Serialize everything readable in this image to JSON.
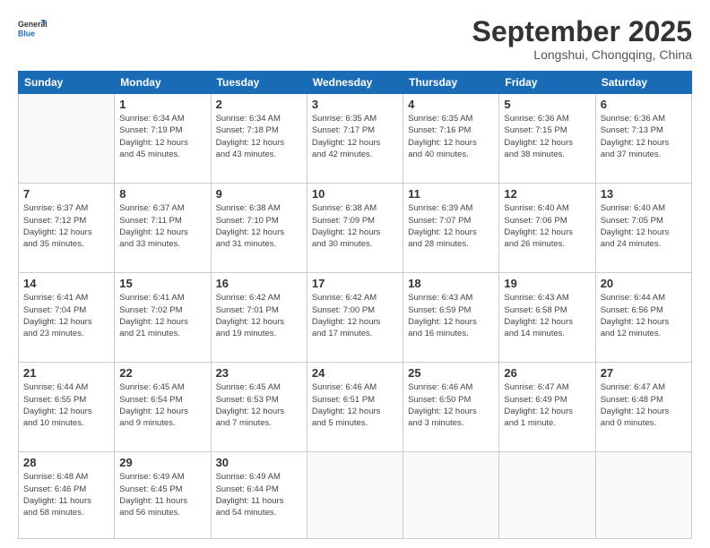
{
  "header": {
    "logo_general": "General",
    "logo_blue": "Blue",
    "month": "September 2025",
    "location": "Longshui, Chongqing, China"
  },
  "days_of_week": [
    "Sunday",
    "Monday",
    "Tuesday",
    "Wednesday",
    "Thursday",
    "Friday",
    "Saturday"
  ],
  "weeks": [
    [
      {
        "day": "",
        "info": ""
      },
      {
        "day": "1",
        "info": "Sunrise: 6:34 AM\nSunset: 7:19 PM\nDaylight: 12 hours\nand 45 minutes."
      },
      {
        "day": "2",
        "info": "Sunrise: 6:34 AM\nSunset: 7:18 PM\nDaylight: 12 hours\nand 43 minutes."
      },
      {
        "day": "3",
        "info": "Sunrise: 6:35 AM\nSunset: 7:17 PM\nDaylight: 12 hours\nand 42 minutes."
      },
      {
        "day": "4",
        "info": "Sunrise: 6:35 AM\nSunset: 7:16 PM\nDaylight: 12 hours\nand 40 minutes."
      },
      {
        "day": "5",
        "info": "Sunrise: 6:36 AM\nSunset: 7:15 PM\nDaylight: 12 hours\nand 38 minutes."
      },
      {
        "day": "6",
        "info": "Sunrise: 6:36 AM\nSunset: 7:13 PM\nDaylight: 12 hours\nand 37 minutes."
      }
    ],
    [
      {
        "day": "7",
        "info": "Sunrise: 6:37 AM\nSunset: 7:12 PM\nDaylight: 12 hours\nand 35 minutes."
      },
      {
        "day": "8",
        "info": "Sunrise: 6:37 AM\nSunset: 7:11 PM\nDaylight: 12 hours\nand 33 minutes."
      },
      {
        "day": "9",
        "info": "Sunrise: 6:38 AM\nSunset: 7:10 PM\nDaylight: 12 hours\nand 31 minutes."
      },
      {
        "day": "10",
        "info": "Sunrise: 6:38 AM\nSunset: 7:09 PM\nDaylight: 12 hours\nand 30 minutes."
      },
      {
        "day": "11",
        "info": "Sunrise: 6:39 AM\nSunset: 7:07 PM\nDaylight: 12 hours\nand 28 minutes."
      },
      {
        "day": "12",
        "info": "Sunrise: 6:40 AM\nSunset: 7:06 PM\nDaylight: 12 hours\nand 26 minutes."
      },
      {
        "day": "13",
        "info": "Sunrise: 6:40 AM\nSunset: 7:05 PM\nDaylight: 12 hours\nand 24 minutes."
      }
    ],
    [
      {
        "day": "14",
        "info": "Sunrise: 6:41 AM\nSunset: 7:04 PM\nDaylight: 12 hours\nand 23 minutes."
      },
      {
        "day": "15",
        "info": "Sunrise: 6:41 AM\nSunset: 7:02 PM\nDaylight: 12 hours\nand 21 minutes."
      },
      {
        "day": "16",
        "info": "Sunrise: 6:42 AM\nSunset: 7:01 PM\nDaylight: 12 hours\nand 19 minutes."
      },
      {
        "day": "17",
        "info": "Sunrise: 6:42 AM\nSunset: 7:00 PM\nDaylight: 12 hours\nand 17 minutes."
      },
      {
        "day": "18",
        "info": "Sunrise: 6:43 AM\nSunset: 6:59 PM\nDaylight: 12 hours\nand 16 minutes."
      },
      {
        "day": "19",
        "info": "Sunrise: 6:43 AM\nSunset: 6:58 PM\nDaylight: 12 hours\nand 14 minutes."
      },
      {
        "day": "20",
        "info": "Sunrise: 6:44 AM\nSunset: 6:56 PM\nDaylight: 12 hours\nand 12 minutes."
      }
    ],
    [
      {
        "day": "21",
        "info": "Sunrise: 6:44 AM\nSunset: 6:55 PM\nDaylight: 12 hours\nand 10 minutes."
      },
      {
        "day": "22",
        "info": "Sunrise: 6:45 AM\nSunset: 6:54 PM\nDaylight: 12 hours\nand 9 minutes."
      },
      {
        "day": "23",
        "info": "Sunrise: 6:45 AM\nSunset: 6:53 PM\nDaylight: 12 hours\nand 7 minutes."
      },
      {
        "day": "24",
        "info": "Sunrise: 6:46 AM\nSunset: 6:51 PM\nDaylight: 12 hours\nand 5 minutes."
      },
      {
        "day": "25",
        "info": "Sunrise: 6:46 AM\nSunset: 6:50 PM\nDaylight: 12 hours\nand 3 minutes."
      },
      {
        "day": "26",
        "info": "Sunrise: 6:47 AM\nSunset: 6:49 PM\nDaylight: 12 hours\nand 1 minute."
      },
      {
        "day": "27",
        "info": "Sunrise: 6:47 AM\nSunset: 6:48 PM\nDaylight: 12 hours\nand 0 minutes."
      }
    ],
    [
      {
        "day": "28",
        "info": "Sunrise: 6:48 AM\nSunset: 6:46 PM\nDaylight: 11 hours\nand 58 minutes."
      },
      {
        "day": "29",
        "info": "Sunrise: 6:49 AM\nSunset: 6:45 PM\nDaylight: 11 hours\nand 56 minutes."
      },
      {
        "day": "30",
        "info": "Sunrise: 6:49 AM\nSunset: 6:44 PM\nDaylight: 11 hours\nand 54 minutes."
      },
      {
        "day": "",
        "info": ""
      },
      {
        "day": "",
        "info": ""
      },
      {
        "day": "",
        "info": ""
      },
      {
        "day": "",
        "info": ""
      }
    ]
  ]
}
